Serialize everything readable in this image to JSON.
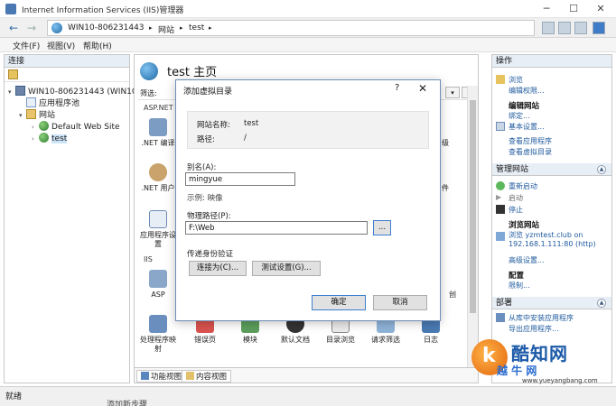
{
  "window": {
    "title": "Internet Information Services (IIS)管理器",
    "controls": {
      "minimize": "─",
      "maximize": "☐",
      "close": "✕"
    }
  },
  "address": {
    "back": "←",
    "forward": "→",
    "crumbs": [
      "WIN10-806231443",
      "▸",
      "网站",
      "▸",
      "test",
      "▸"
    ]
  },
  "menu": [
    "文件(F)",
    "视图(V)",
    "帮助(H)"
  ],
  "connections": {
    "header": "连接",
    "tree": [
      {
        "label": "WIN10-806231443 (WIN10",
        "twisty": "▾"
      },
      {
        "label": "应用程序池",
        "twisty": ""
      },
      {
        "label": "网站",
        "twisty": "▾"
      },
      {
        "label": "Default Web Site",
        "twisty": "›"
      },
      {
        "label": "test",
        "twisty": "›"
      }
    ]
  },
  "center": {
    "title": "test 主页",
    "filter_label": "筛选:",
    "sections": {
      "aspnet": "ASP.NET",
      "iis": "IIS"
    },
    "features": {
      "net_compile": ".NET 编译",
      "net_users": ".NET 用户",
      "app_settings": "应用程序设置",
      "asp": "ASP",
      "handler_mappings": "处理程序映射",
      "error_pages": "错误页",
      "modules": "模块",
      "default_document": "默认文档",
      "dir_browsing": "目录浏览",
      "request_filtering": "请求筛选",
      "logging": "日志"
    },
    "partial_labels": {
      "right1": "级",
      "right2": "件",
      "right3": "创"
    },
    "tabs": {
      "features_view": "功能视图",
      "content_view": "内容视图"
    }
  },
  "actions": {
    "header": "操作",
    "browse": "浏览",
    "edit_permissions": "编辑权限...",
    "edit_site": "编辑网站",
    "bindings": "绑定...",
    "basic_settings": "基本设置...",
    "view_apps": "查看应用程序",
    "view_vdirs": "查看虚拟目录",
    "manage_site": "管理网站",
    "restart": "重新启动",
    "start": "启动",
    "stop": "停止",
    "browse_site": "浏览网站",
    "browse_url": "浏览 yzmtest.club on",
    "browse_url2": "192.168.1.111:80 (http)",
    "advanced": "高级设置...",
    "config": "配置",
    "limits": "限制...",
    "deploy": "部署",
    "install_from_gallery": "从库中安装应用程序",
    "export_app": "导出应用程序..."
  },
  "dialog": {
    "title": "添加虚拟目录",
    "help": "?",
    "close": "✕",
    "site_name_label": "网站名称:",
    "site_name": "test",
    "path_label": "路径:",
    "path": "/",
    "alias_label": "别名(A):",
    "alias_value": "mingyue",
    "example": "示例: 映像",
    "physical_path_label": "物理路径(P):",
    "physical_path_value": "F:\\Web",
    "browse_button": "...",
    "passthrough_label": "传递身份验证",
    "connect_as": "连接为(C)...",
    "test_settings": "测试设置(G)...",
    "ok": "确定",
    "cancel": "取消"
  },
  "status": {
    "text": "就绪",
    "taskbar": "添加新步骤"
  },
  "watermark": {
    "k": "k",
    "name": "酷知网",
    "sub": "越 牛 网",
    "url": "www.yueyangbang.com"
  }
}
